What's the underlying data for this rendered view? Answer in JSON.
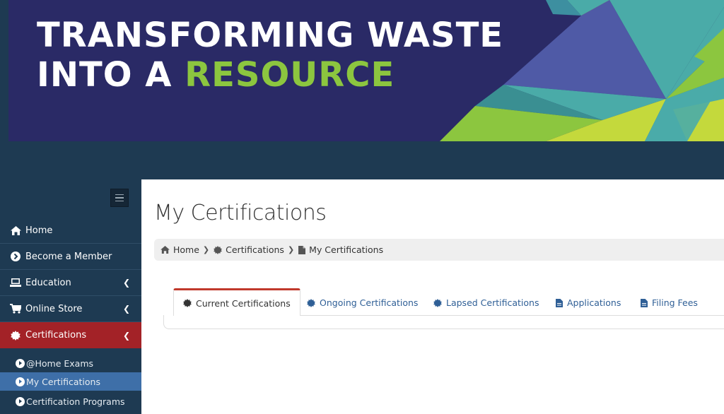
{
  "banner": {
    "line1": "TRANSFORMING WASTE",
    "line2_prefix": "INTO A ",
    "line2_accent": "RESOURCE",
    "colors": {
      "background": "#2a2a66",
      "accent": "#8cc63f",
      "teal": "#4aaba8",
      "lime": "#c4d93c",
      "indigo": "#4f5aa6"
    }
  },
  "sidebar": {
    "menu_toggle_icon": "hamburger-icon",
    "items": [
      {
        "label": "Home",
        "icon": "home-icon"
      },
      {
        "label": "Become a Member",
        "icon": "circle-arrow-icon"
      },
      {
        "label": "Education",
        "icon": "laptop-icon",
        "expandable": true
      },
      {
        "label": "Online Store",
        "icon": "cart-icon",
        "expandable": true
      },
      {
        "label": "Certifications",
        "icon": "certificate-icon",
        "expandable": true,
        "active": true
      }
    ],
    "sub_items": [
      {
        "label": "@Home Exams"
      },
      {
        "label": "My Certifications",
        "selected": true
      },
      {
        "label": "Certification Programs"
      }
    ]
  },
  "main": {
    "title": "My Certifications",
    "breadcrumb": [
      {
        "label": "Home",
        "icon": "home-icon"
      },
      {
        "label": "Certifications",
        "icon": "certificate-icon"
      },
      {
        "label": "My Certifications",
        "icon": "file-icon"
      }
    ],
    "tabs": [
      {
        "label": "Current Certifications",
        "icon": "certificate-icon",
        "active": true
      },
      {
        "label": "Ongoing Certifications",
        "icon": "certificate-icon"
      },
      {
        "label": "Lapsed Certifications",
        "icon": "certificate-icon"
      },
      {
        "label": "Applications",
        "icon": "document-icon"
      },
      {
        "label": "Filing Fees",
        "icon": "document-icon"
      }
    ]
  }
}
